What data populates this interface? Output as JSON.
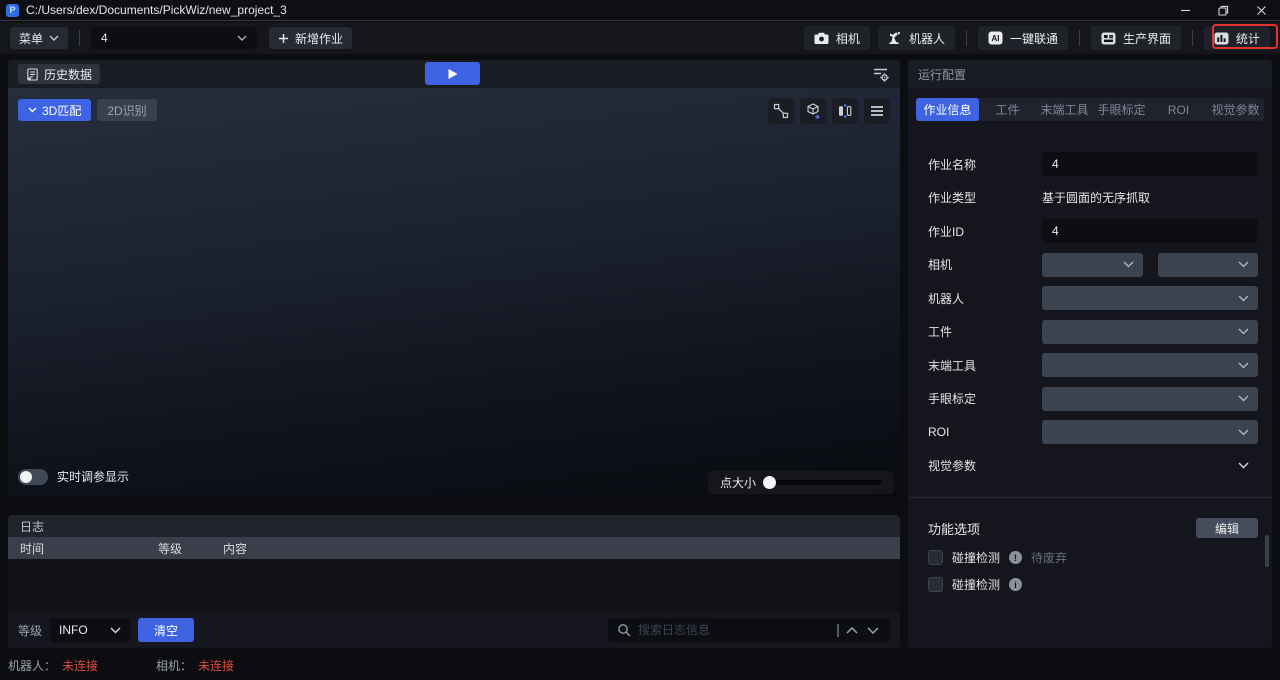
{
  "titlebar": {
    "title": "C:/Users/dex/Documents/PickWiz/new_project_3",
    "logo_letter": "P"
  },
  "toolbar": {
    "menu_label": "菜单",
    "job_select_value": "4",
    "add_job_label": "新增作业",
    "camera_label": "相机",
    "robot_label": "机器人",
    "ai_icon_text": "AI",
    "ai_connect_label": "一键联通",
    "production_label": "生产界面",
    "stats_label": "统计"
  },
  "viewer": {
    "history_label": "历史数据",
    "tab_3d": "3D匹配",
    "tab_2d": "2D识别",
    "realtime_toggle_label": "实时调参显示",
    "point_size_label": "点大小"
  },
  "log": {
    "title": "日志",
    "col_time": "时间",
    "col_level": "等级",
    "col_content": "内容",
    "rows": [],
    "level_label": "等级",
    "level_value": "INFO",
    "clear_label": "清空",
    "search_placeholder": "搜索日志信息"
  },
  "config": {
    "title": "运行配置",
    "tabs": [
      "作业信息",
      "工件",
      "末端工具",
      "手眼标定",
      "ROI",
      "视觉参数"
    ],
    "active_tab": "作业信息",
    "job_name_label": "作业名称",
    "job_name_value": "4",
    "job_type_label": "作业类型",
    "job_type_value": "基于圆面的无序抓取",
    "job_id_label": "作业ID",
    "job_id_value": "4",
    "camera_label": "相机",
    "robot_label": "机器人",
    "workpiece_label": "工件",
    "end_tool_label": "末端工具",
    "hand_eye_label": "手眼标定",
    "roi_label": "ROI",
    "vision_label": "视觉参数",
    "options_title": "功能选项",
    "edit_label": "编辑",
    "option1_label": "碰撞检测",
    "option1_note": "待废弃",
    "option2_label": "碰撞检测"
  },
  "statusbar": {
    "robot_label": "机器人：",
    "robot_value": "未连接",
    "camera_label": "相机：",
    "camera_value": "未连接"
  },
  "colors": {
    "accent_blue": "#3d63e3",
    "status_red": "#dd4a3d",
    "annotation_red": "#e2352b"
  }
}
